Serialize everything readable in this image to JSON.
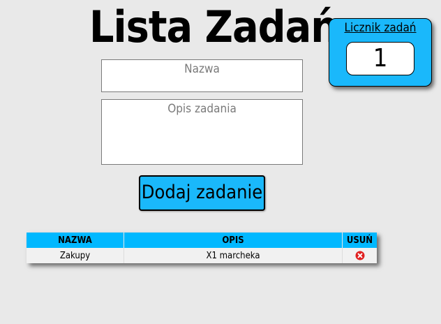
{
  "header": {
    "title": "Lista Zadań"
  },
  "counter": {
    "label": "Licznik zadań",
    "value": "1"
  },
  "form": {
    "name_placeholder": "Nazwa",
    "description_placeholder": "Opis zadania",
    "add_button_label": "Dodaj zadanie"
  },
  "table": {
    "headers": {
      "name": "NAZWA",
      "description": "OPIS",
      "delete": "USUŃ"
    },
    "rows": [
      {
        "name": "Zakupy",
        "description": "X1 marcheka",
        "delete_icon": "close-circle-icon"
      }
    ]
  },
  "colors": {
    "background": "#e9e9e9",
    "accent": "#1ab8fb",
    "delete": "#e02020"
  }
}
